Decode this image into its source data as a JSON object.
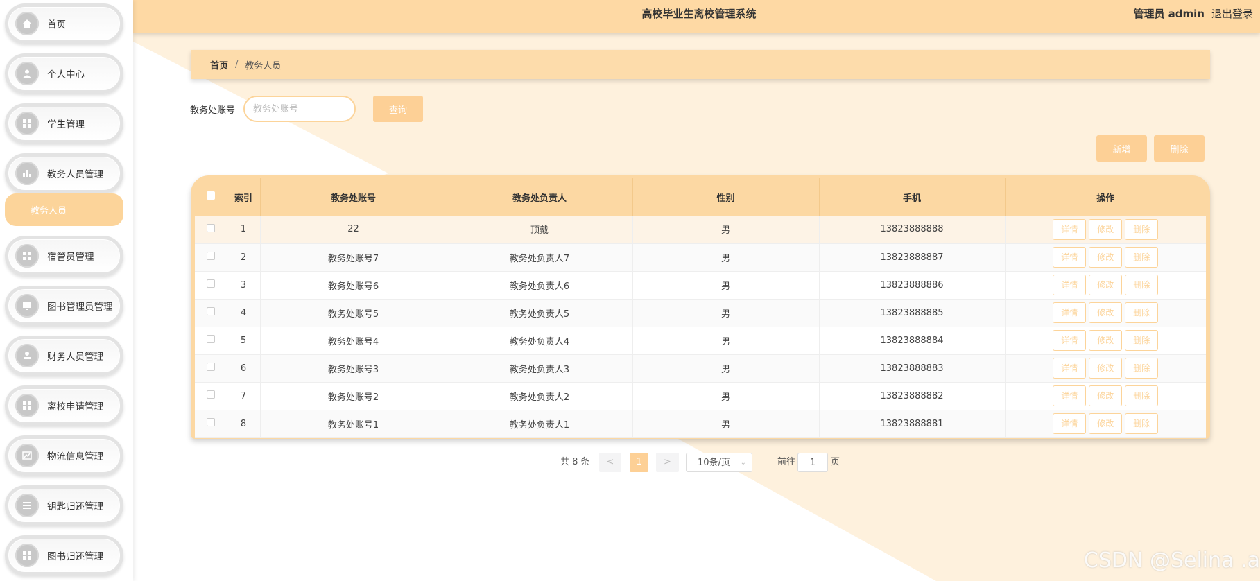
{
  "header": {
    "title": "高校毕业生离校管理系统",
    "user": "管理员 admin",
    "logout": "退出登录"
  },
  "sidebar": {
    "items": [
      {
        "label": "首页",
        "icon": "home-icon"
      },
      {
        "label": "个人中心",
        "icon": "user-icon"
      },
      {
        "label": "学生管理",
        "icon": "grid-icon"
      },
      {
        "label": "教务人员管理",
        "icon": "bar-chart-icon"
      },
      {
        "label": "宿管员管理",
        "icon": "grid-icon"
      },
      {
        "label": "图书管理员管理",
        "icon": "monitor-icon"
      },
      {
        "label": "财务人员管理",
        "icon": "stamp-icon"
      },
      {
        "label": "离校申请管理",
        "icon": "grid-icon"
      },
      {
        "label": "物流信息管理",
        "icon": "trend-icon"
      },
      {
        "label": "钥匙归还管理",
        "icon": "list-icon"
      },
      {
        "label": "图书归还管理",
        "icon": "grid-icon"
      }
    ],
    "sub_item": "教务人员"
  },
  "breadcrumb": {
    "home": "首页",
    "sep": "/",
    "current": "教务人员"
  },
  "search": {
    "label": "教务处账号",
    "placeholder": "教务处账号",
    "query_button": "查询"
  },
  "actions": {
    "add": "新增",
    "delete": "删除"
  },
  "table": {
    "headers": [
      "索引",
      "教务处账号",
      "教务处负责人",
      "性别",
      "手机",
      "操作"
    ],
    "rows": [
      {
        "idx": "1",
        "account": "22",
        "leader": "顶戴",
        "gender": "男",
        "phone": "13823888888"
      },
      {
        "idx": "2",
        "account": "教务处账号7",
        "leader": "教务处负责人7",
        "gender": "男",
        "phone": "13823888887"
      },
      {
        "idx": "3",
        "account": "教务处账号6",
        "leader": "教务处负责人6",
        "gender": "男",
        "phone": "13823888886"
      },
      {
        "idx": "4",
        "account": "教务处账号5",
        "leader": "教务处负责人5",
        "gender": "男",
        "phone": "13823888885"
      },
      {
        "idx": "5",
        "account": "教务处账号4",
        "leader": "教务处负责人4",
        "gender": "男",
        "phone": "13823888884"
      },
      {
        "idx": "6",
        "account": "教务处账号3",
        "leader": "教务处负责人3",
        "gender": "男",
        "phone": "13823888883"
      },
      {
        "idx": "7",
        "account": "教务处账号2",
        "leader": "教务处负责人2",
        "gender": "男",
        "phone": "13823888882"
      },
      {
        "idx": "8",
        "account": "教务处账号1",
        "leader": "教务处负责人1",
        "gender": "男",
        "phone": "13823888881"
      }
    ],
    "ops": {
      "detail": "详情",
      "edit": "修改",
      "delete": "删除"
    }
  },
  "pagination": {
    "total": "共 8 条",
    "prev": "<",
    "current_page": "1",
    "next": ">",
    "page_size": "10条/页",
    "goto_label": "前往",
    "goto_value": "1",
    "page_unit": "页"
  },
  "watermark": "CSDN @Selina .a",
  "colors": {
    "accent": "#fdd096",
    "header": "#fed9a4"
  }
}
